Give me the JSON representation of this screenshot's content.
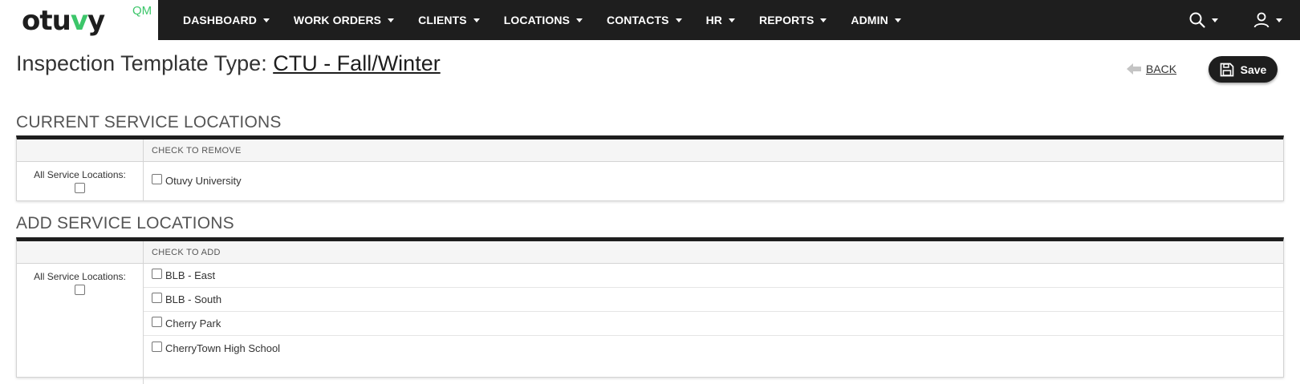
{
  "logo": {
    "text_pre": "otu",
    "text_v": "v",
    "text_post": "y",
    "sup": "QM"
  },
  "nav": {
    "items": [
      {
        "label": "DASHBOARD"
      },
      {
        "label": "WORK ORDERS"
      },
      {
        "label": "CLIENTS"
      },
      {
        "label": "LOCATIONS"
      },
      {
        "label": "CONTACTS"
      },
      {
        "label": "HR"
      },
      {
        "label": "REPORTS"
      },
      {
        "label": "ADMIN"
      }
    ],
    "search_icon": "search-icon",
    "user_icon": "user-icon"
  },
  "header": {
    "title_prefix": "Inspection Template Type: ",
    "template_name": "CTU - Fall/Winter",
    "back_label": "BACK",
    "save_label": "Save"
  },
  "current": {
    "title": "CURRENT SERVICE LOCATIONS",
    "column_header": "CHECK TO REMOVE",
    "all_label": "All Service Locations:",
    "locations": [
      "Otuvy University"
    ]
  },
  "add": {
    "title": "ADD SERVICE LOCATIONS",
    "column_header": "CHECK TO ADD",
    "all_label": "All Service Locations:",
    "locations": [
      "BLB - East",
      "BLB - South",
      "Cherry Park",
      "CherryTown High School"
    ]
  },
  "colors": {
    "nav_bg": "#1e1e1e",
    "accent_green": "#3cc66a",
    "save_bg": "#1e1e1e"
  }
}
